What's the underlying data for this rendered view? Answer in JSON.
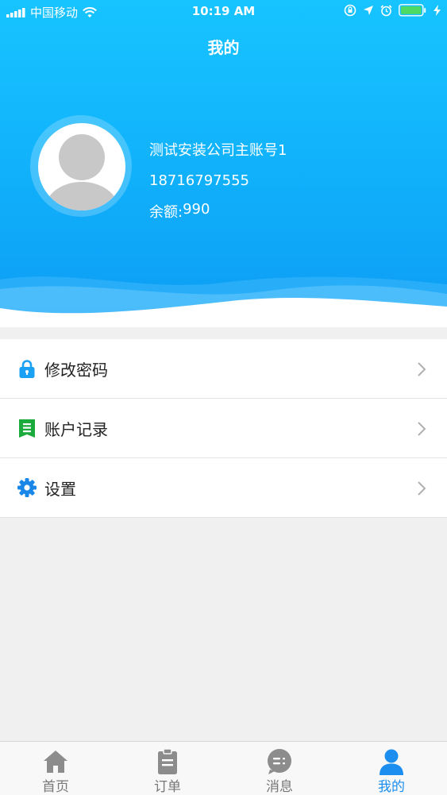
{
  "status_bar": {
    "carrier": "中国移动",
    "time": "10:19 AM"
  },
  "header": {
    "title": "我的"
  },
  "user": {
    "name": "测试安装公司主账号1",
    "phone": "18716797555",
    "balance_label": "余额:",
    "balance_value": "990"
  },
  "menu": {
    "items": [
      {
        "label": "修改密码",
        "icon": "lock-icon",
        "icon_color": "#1aa0f5"
      },
      {
        "label": "账户记录",
        "icon": "record-book-icon",
        "icon_color": "#1bab3c"
      },
      {
        "label": "设置",
        "icon": "gear-icon",
        "icon_color": "#1a86e8"
      }
    ]
  },
  "tabbar": {
    "tabs": [
      {
        "label": "首页",
        "icon": "home-icon",
        "active": false
      },
      {
        "label": "订单",
        "icon": "clipboard-icon",
        "active": false
      },
      {
        "label": "消息",
        "icon": "chat-bubble-icon",
        "active": false
      },
      {
        "label": "我的",
        "icon": "person-icon",
        "active": true
      }
    ]
  },
  "colors": {
    "header_top": "#17c4ff",
    "header_bottom": "#0c9cf4",
    "active_tab": "#1b8ef0",
    "inactive_tab": "#777777",
    "page_background": "#f0f0f0"
  }
}
